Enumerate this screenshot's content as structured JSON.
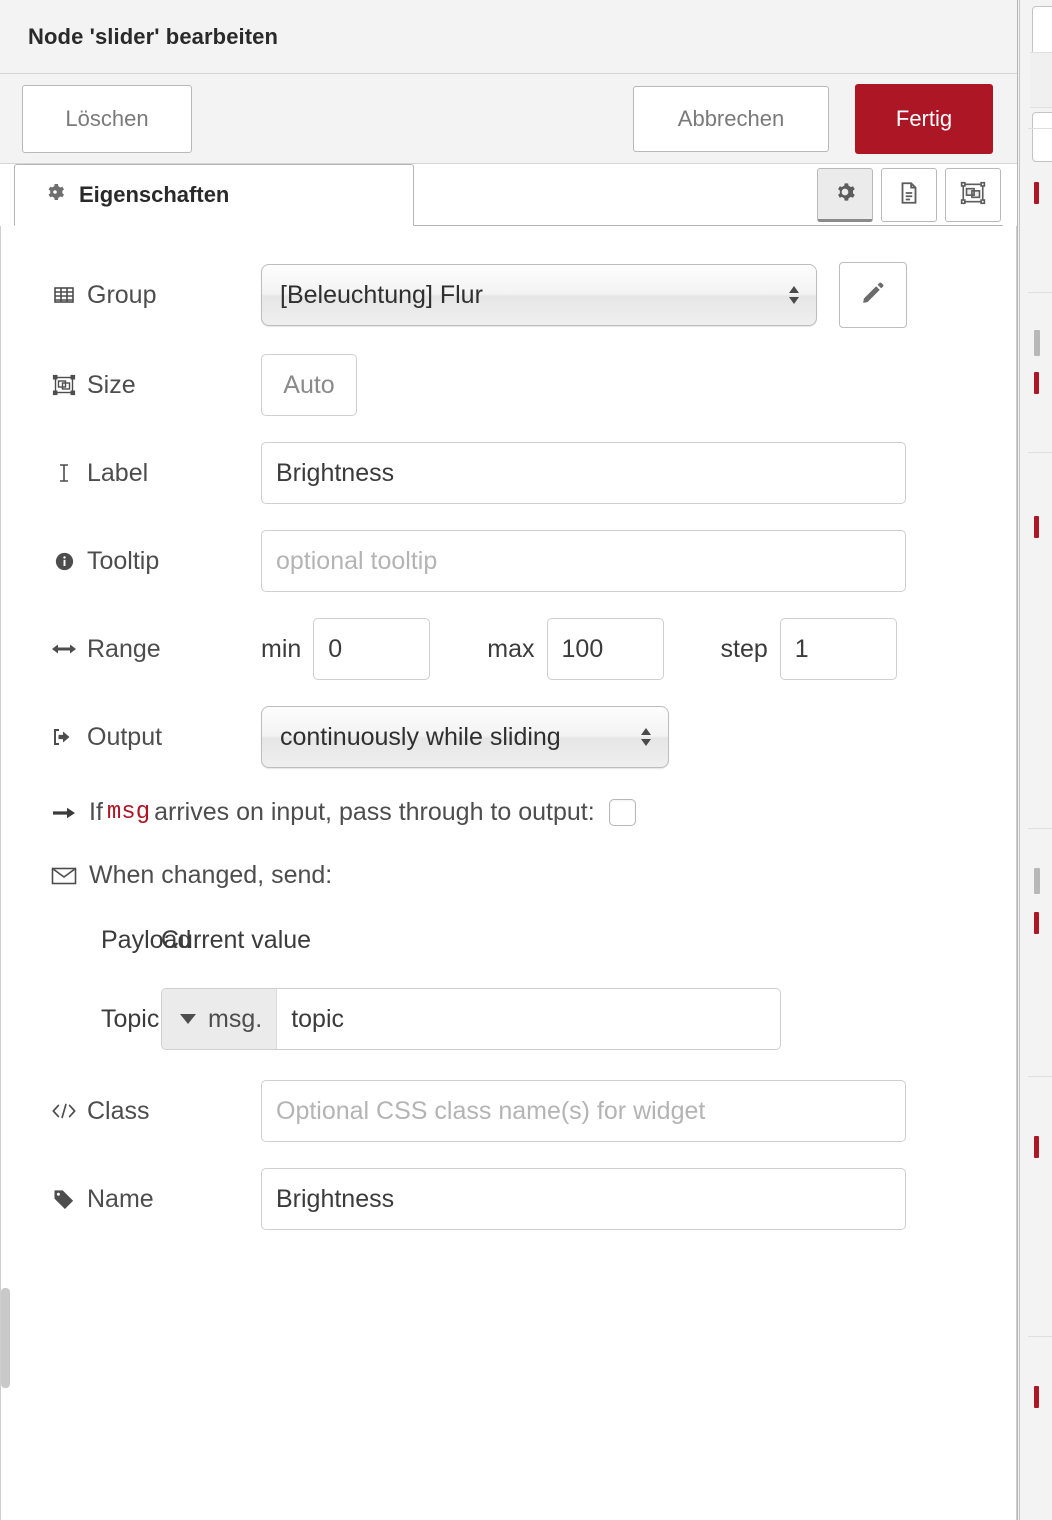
{
  "dialog": {
    "title": "Node 'slider' bearbeiten",
    "buttons": {
      "delete": "Löschen",
      "cancel": "Abbrechen",
      "done": "Fertig"
    },
    "accent_color": "#ad1625"
  },
  "tabs": {
    "active": "Eigenschaften",
    "items": [
      {
        "label": "Eigenschaften",
        "icon": "gear-icon",
        "active": true
      }
    ],
    "tools": [
      {
        "name": "properties-tool",
        "icon": "gear-icon",
        "active": true
      },
      {
        "name": "description-tool",
        "icon": "document-icon",
        "active": false
      },
      {
        "name": "appearance-tool",
        "icon": "object-group-icon",
        "active": false
      }
    ]
  },
  "form": {
    "group": {
      "label": "Group",
      "icon": "table-icon",
      "value": "[Beleuchtung] Flur",
      "edit_icon": "pencil-icon"
    },
    "size": {
      "label": "Size",
      "icon": "object-group-icon",
      "value": "Auto"
    },
    "label": {
      "label": "Label",
      "icon": "text-cursor-icon",
      "value": "Brightness"
    },
    "tooltip": {
      "label": "Tooltip",
      "icon": "info-circle-icon",
      "value": "",
      "placeholder": "optional tooltip"
    },
    "range": {
      "label": "Range",
      "icon": "arrows-h-icon",
      "min_label": "min",
      "min_value": "0",
      "max_label": "max",
      "max_value": "100",
      "step_label": "step",
      "step_value": "1"
    },
    "output": {
      "label": "Output",
      "icon": "sign-out-icon",
      "value": "continuously while sliding"
    },
    "passthrough": {
      "icon": "arrow-right-icon",
      "text_before": "If",
      "code": "msg",
      "text_after": "arrives on input, pass through to output:",
      "checked": false
    },
    "when_changed": {
      "icon": "envelope-icon",
      "label": "When changed, send:"
    },
    "payload": {
      "label": "Payload",
      "value": "Current value"
    },
    "topic": {
      "label": "Topic",
      "type_prefix": "msg.",
      "value": "topic"
    },
    "class": {
      "label": "Class",
      "icon": "code-icon",
      "value": "",
      "placeholder": "Optional CSS class name(s) for widget"
    },
    "name": {
      "label": "Name",
      "icon": "tag-icon",
      "value": "Brightness"
    }
  }
}
